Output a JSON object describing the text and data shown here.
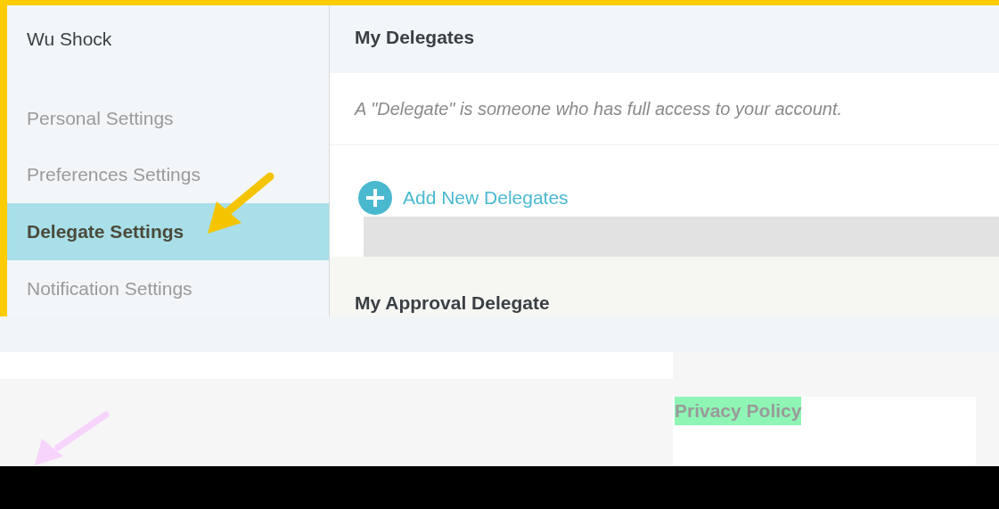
{
  "user": {
    "name": "Wu Shock"
  },
  "sidebar": {
    "items": [
      {
        "label": "Personal Settings",
        "selected": false
      },
      {
        "label": "Preferences Settings",
        "selected": false
      },
      {
        "label": "Delegate Settings",
        "selected": true
      },
      {
        "label": "Notification Settings",
        "selected": false
      }
    ]
  },
  "delegates": {
    "title": "My Delegates",
    "description": "A \"Delegate\" is someone who has full access to your account.",
    "add_link": "Add New Delegates"
  },
  "approval": {
    "title": "My Approval Delegate"
  },
  "footer": {
    "link": "Privacy Policy"
  }
}
